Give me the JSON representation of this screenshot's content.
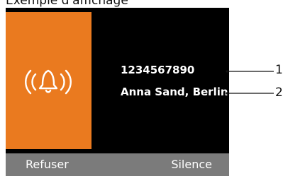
{
  "caption": "Exemple d'affichage",
  "call": {
    "number": "1234567890",
    "name": "Anna Sand, Berlin"
  },
  "softkeys": {
    "left": "Refuser",
    "right": "Silence"
  },
  "callouts": {
    "number_marker": "1",
    "name_marker": "2"
  },
  "colors": {
    "accent": "#ea7a1f",
    "screen": "#000000",
    "softkey_bar": "#7b7b7b"
  },
  "icons": [
    "ringing-bell-icon"
  ]
}
